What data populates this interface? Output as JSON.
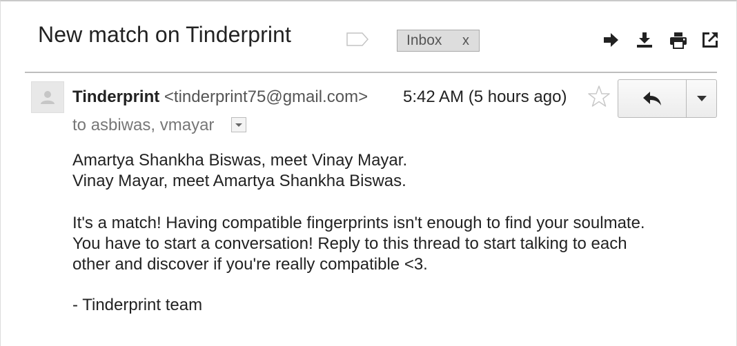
{
  "email": {
    "subject": "New match on Tinderprint",
    "label_chip": {
      "label": "Inbox",
      "remove_label": "x"
    },
    "toolbar": {
      "icons": [
        "forward-arrow-icon",
        "download-icon",
        "print-icon",
        "open-in-new-window-icon"
      ]
    },
    "message": {
      "sender_name": "Tinderprint",
      "sender_email": "<tinderprint75@gmail.com>",
      "timestamp": "5:42 AM (5 hours ago)",
      "recipients_prefix": "to",
      "recipients": "asbiwas, vmayar",
      "body": {
        "intro_line_1": "Amartya Shankha Biswas, meet Vinay Mayar.",
        "intro_line_2": "Vinay Mayar, meet Amartya Shankha Biswas.",
        "paragraph_line_1": "It's a match!  Having compatible fingerprints isn't enough to find your soulmate.",
        "paragraph_line_2": "You have to start a conversation!  Reply to this thread to start talking to each",
        "paragraph_line_3": "other and discover if you're really compatible <3.",
        "signature": "- Tinderprint team"
      }
    }
  },
  "colors": {
    "text_primary": "#222222",
    "text_secondary": "#777777",
    "chip_background": "#dddddd",
    "divider": "#bdbdbd"
  }
}
